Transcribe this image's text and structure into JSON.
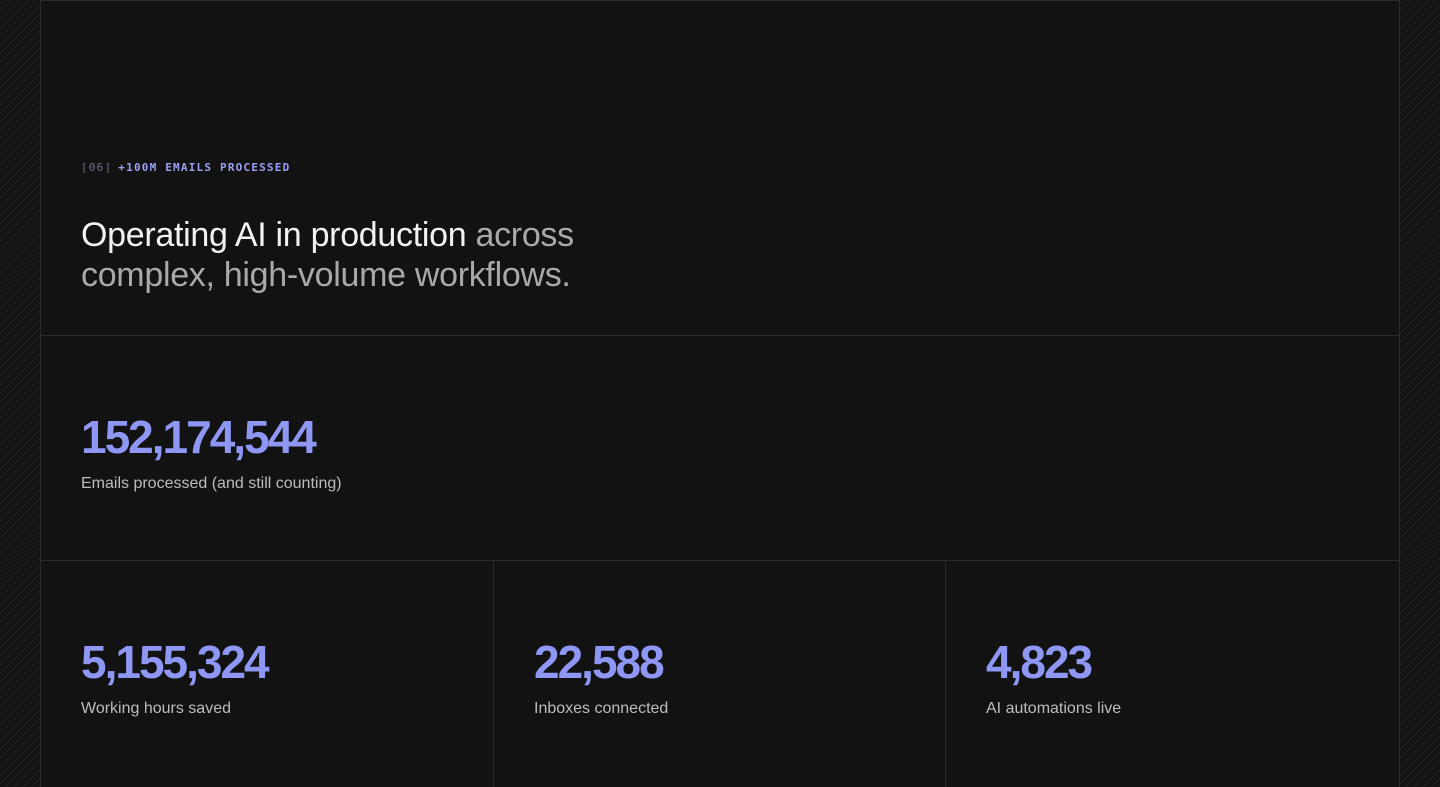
{
  "section": {
    "index": "[06]",
    "eyebrow": "+100M EMAILS PROCESSED",
    "headline_strong": "Operating AI in production",
    "headline_muted": " across complex, high-volume workflows."
  },
  "stats": {
    "primary": {
      "value": "152,174,544",
      "label": "Emails processed (and still counting)"
    },
    "items": [
      {
        "value": "5,155,324",
        "label": "Working hours saved"
      },
      {
        "value": "22,588",
        "label": "Inboxes connected"
      },
      {
        "value": "4,823",
        "label": "AI automations live"
      }
    ]
  },
  "colors": {
    "background": "#121212",
    "accent": "#8f97f5",
    "eyebrow_accent": "#9aa0f2",
    "headline": "#f2f2f2",
    "headline_muted": "#a9a9a9",
    "label": "#bdbdbd",
    "divider": "#2a2a2a"
  }
}
